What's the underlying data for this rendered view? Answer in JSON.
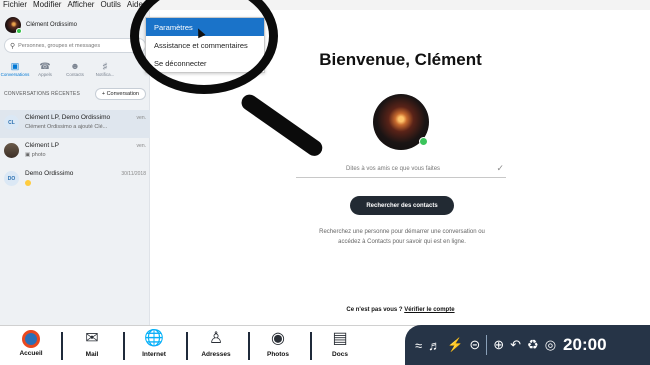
{
  "menubar": {
    "items": [
      "Fichier",
      "Modifier",
      "Afficher",
      "Outils",
      "Aide"
    ]
  },
  "profile": {
    "name": "Clément Ordissimo"
  },
  "search": {
    "placeholder": "Personnes, groupes et messages"
  },
  "nav_tabs": [
    {
      "label": "Conversations",
      "icon": "chat-icon"
    },
    {
      "label": "Appels",
      "icon": "phone-icon"
    },
    {
      "label": "Contacts",
      "icon": "contacts-icon"
    },
    {
      "label": "Notifica...",
      "icon": "bell-icon"
    }
  ],
  "recent": {
    "title": "CONVERSATIONS RÉCENTES",
    "new_conversation": "Conversation"
  },
  "conversations": [
    {
      "initials": "CL",
      "name": "Clément LP, Demo Ordissimo",
      "preview": "Clément Ordissimo a ajouté Clé...",
      "date": "ven."
    },
    {
      "initials": "",
      "name": "Clément LP",
      "preview": "photo",
      "date": "ven."
    },
    {
      "initials": "DO",
      "name": "Demo Ordissimo",
      "preview": "",
      "date": "30/11/2018"
    }
  ],
  "dropdown": {
    "items": [
      "Paramètres",
      "Assistance et commentaires",
      "Se déconnecter"
    ],
    "active_index": 0
  },
  "main": {
    "welcome": "Bienvenue, Clément",
    "mood_placeholder": "Dites à vos amis ce que vous faites",
    "search_contacts": "Rechercher des contacts",
    "hint": "Recherchez une personne pour démarrer une conversation ou accédez à Contacts pour savoir qui est en ligne.",
    "not_you": "Ce n'est pas vous ?",
    "verify": "Vérifier le compte"
  },
  "taskbar": {
    "items": [
      {
        "label": "Accueil",
        "icon": "home-logo-icon"
      },
      {
        "label": "Mail",
        "icon": "mail-icon"
      },
      {
        "label": "Internet",
        "icon": "globe-icon"
      },
      {
        "label": "Adresses",
        "icon": "address-book-icon"
      },
      {
        "label": "Photos",
        "icon": "camera-icon"
      },
      {
        "label": "Docs",
        "icon": "documents-icon"
      }
    ],
    "clock": "20:00"
  },
  "colors": {
    "accent": "#0078d4",
    "menu_highlight": "#1a73c9",
    "online": "#36c24a",
    "tray": "#263447",
    "button_dark": "#222a33"
  }
}
